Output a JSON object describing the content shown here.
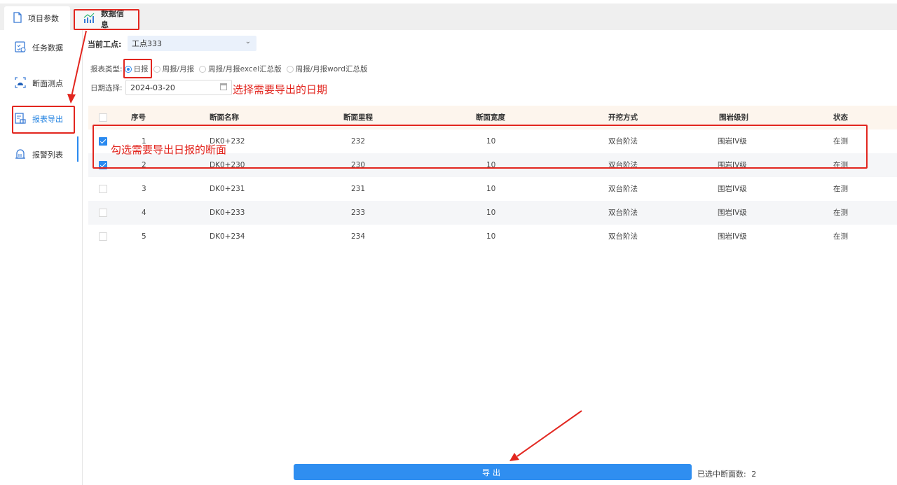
{
  "tabs": [
    {
      "label": "项目参数",
      "icon": "document-icon"
    },
    {
      "label": "数据信息",
      "icon": "chart-icon"
    }
  ],
  "sidebar": {
    "items": [
      {
        "label": "任务数据",
        "icon": "task-clipboard-icon"
      },
      {
        "label": "断面测点",
        "icon": "section-point-icon"
      },
      {
        "label": "报表导出",
        "icon": "report-export-icon"
      },
      {
        "label": "报警列表",
        "icon": "alarm-bell-icon"
      }
    ]
  },
  "filters": {
    "workpoint_label": "当前工点:",
    "workpoint_value": "工点333",
    "report_type_label": "报表类型:",
    "report_types": [
      "日报",
      "周报/月报",
      "周报/月报excel汇总版",
      "周报/月报word汇总版"
    ],
    "date_label": "日期选择:",
    "date_value": "2024-03-20"
  },
  "annotations": {
    "date_hint": "选择需要导出的日期",
    "rows_hint": "勾选需要导出日报的断面"
  },
  "table": {
    "headers": [
      "序号",
      "断面名称",
      "断面里程",
      "断面宽度",
      "开挖方式",
      "围岩级别",
      "状态"
    ],
    "rows": [
      {
        "checked": true,
        "cells": [
          "1",
          "DK0+232",
          "232",
          "10",
          "双台阶法",
          "围岩IV级",
          "在测"
        ]
      },
      {
        "checked": true,
        "cells": [
          "2",
          "DK0+230",
          "230",
          "10",
          "双台阶法",
          "围岩IV级",
          "在测"
        ]
      },
      {
        "checked": false,
        "cells": [
          "3",
          "DK0+231",
          "231",
          "10",
          "双台阶法",
          "围岩IV级",
          "在测"
        ]
      },
      {
        "checked": false,
        "cells": [
          "4",
          "DK0+233",
          "233",
          "10",
          "双台阶法",
          "围岩IV级",
          "在测"
        ]
      },
      {
        "checked": false,
        "cells": [
          "5",
          "DK0+234",
          "234",
          "10",
          "双台阶法",
          "围岩IV级",
          "在测"
        ]
      }
    ]
  },
  "footer": {
    "export_label": "导出",
    "selected_label": "已选中断面数:",
    "selected_count": "2"
  },
  "colors": {
    "accent": "#2f8ef0",
    "annotation": "#e2261f"
  }
}
